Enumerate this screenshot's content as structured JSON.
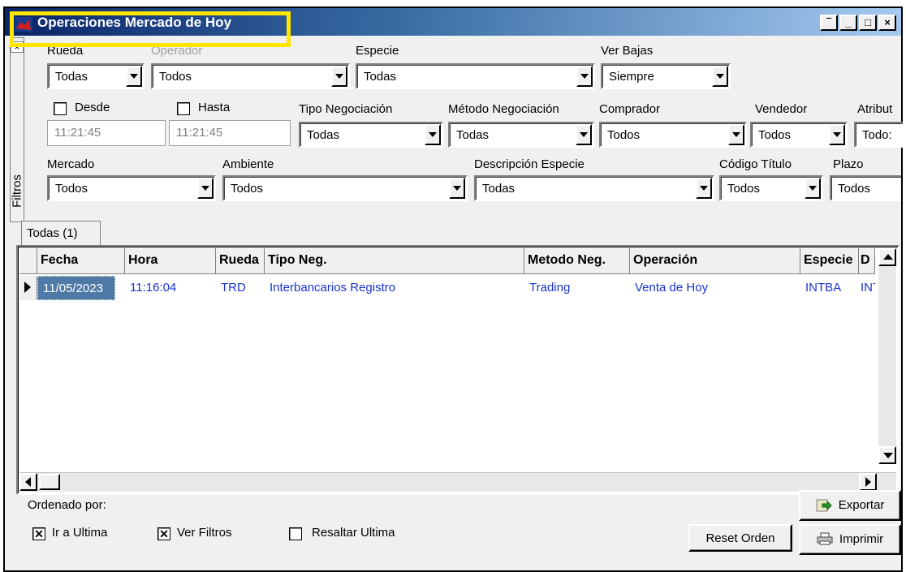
{
  "window": {
    "title": "Operaciones Mercado de Hoy",
    "title_buttons": [
      "pin-icon",
      "minimize-icon",
      "maximize-icon",
      "close-icon"
    ]
  },
  "filters": {
    "panel_label": "Filtros",
    "rueda": {
      "label": "Rueda",
      "value": "Todas"
    },
    "operador": {
      "label": "Operador",
      "value": "Todos"
    },
    "especie": {
      "label": "Especie",
      "value": "Todas"
    },
    "ver_bajas": {
      "label": "Ver Bajas",
      "value": "Siempre"
    },
    "desde": {
      "label": "Desde",
      "value": "11:21:45"
    },
    "hasta": {
      "label": "Hasta",
      "value": "11:21:45"
    },
    "tipo_negociacion": {
      "label": "Tipo Negociación",
      "value": "Todas"
    },
    "metodo_negociacion": {
      "label": "Método Negociación",
      "value": "Todas"
    },
    "comprador": {
      "label": "Comprador",
      "value": "Todos"
    },
    "vendedor": {
      "label": "Vendedor",
      "value": "Todos"
    },
    "atributo": {
      "label": "Atribut",
      "value": "Todo:"
    },
    "mercado": {
      "label": "Mercado",
      "value": "Todos"
    },
    "ambiente": {
      "label": "Ambiente",
      "value": "Todos"
    },
    "descripcion_especie": {
      "label": "Descripción Especie",
      "value": "Todas"
    },
    "codigo_titulo": {
      "label": "Código Título",
      "value": "Todos"
    },
    "plazo": {
      "label": "Plazo",
      "value": "Todos"
    }
  },
  "tabs": [
    {
      "label": "Todas (1)"
    }
  ],
  "grid": {
    "columns": [
      "Fecha",
      "Hora",
      "Rueda",
      "Tipo Neg.",
      "Metodo Neg.",
      "Operación",
      "Especie",
      "D"
    ],
    "rows": [
      [
        "11/05/2023",
        "11:16:04",
        "TRD",
        "Interbancarios Registro",
        "Trading",
        "Venta de Hoy",
        "INTBA",
        "INT"
      ]
    ]
  },
  "footer": {
    "ordenado_por": "Ordenado por:",
    "ir_a_ultima": {
      "label": "Ir a Ultima",
      "checked": true
    },
    "ver_filtros": {
      "label": "Ver Filtros",
      "checked": true
    },
    "resaltar_ultima": {
      "label": "Resaltar Ultima",
      "checked": false
    },
    "reset_orden": "Reset Orden",
    "exportar": "Exportar",
    "imprimir": "Imprimir"
  },
  "colors": {
    "highlight": "#ffe600",
    "cell_text": "#1a33cc",
    "selected": "#4f7aa8"
  }
}
